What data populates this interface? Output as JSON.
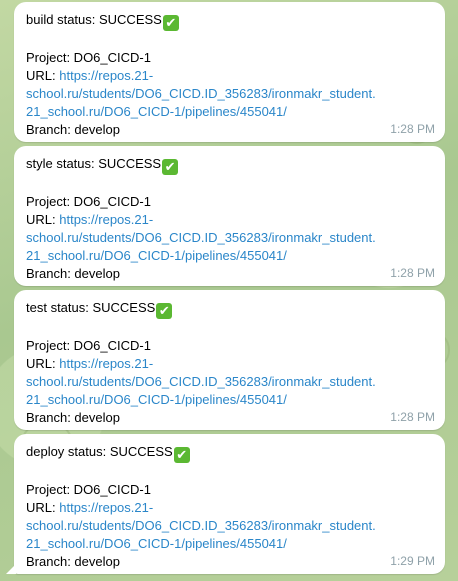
{
  "messages": [
    {
      "status_line": "build status: SUCCESS",
      "status_icon": "white-check-mark-emoji",
      "project_line": "Project: DO6_CICD-1",
      "url_label": "URL: ",
      "url_line1": "https://repos.21-",
      "url_line2": "school.ru/students/DO6_CICD.ID_356283/ironmakr_student.",
      "url_line3": "21_school.ru/DO6_CICD-1/pipelines/455041/",
      "branch_line": "Branch: develop",
      "time": "1:28 PM"
    },
    {
      "status_line": "style status: SUCCESS",
      "status_icon": "white-check-mark-emoji",
      "project_line": "Project: DO6_CICD-1",
      "url_label": "URL: ",
      "url_line1": "https://repos.21-",
      "url_line2": "school.ru/students/DO6_CICD.ID_356283/ironmakr_student.",
      "url_line3": "21_school.ru/DO6_CICD-1/pipelines/455041/",
      "branch_line": "Branch: develop",
      "time": "1:28 PM"
    },
    {
      "status_line": "test status: SUCCESS",
      "status_icon": "white-check-mark-emoji",
      "project_line": "Project: DO6_CICD-1",
      "url_label": "URL: ",
      "url_line1": "https://repos.21-",
      "url_line2": "school.ru/students/DO6_CICD.ID_356283/ironmakr_student.",
      "url_line3": "21_school.ru/DO6_CICD-1/pipelines/455041/",
      "branch_line": "Branch: develop",
      "time": "1:28 PM"
    },
    {
      "status_line": "deploy status: SUCCESS",
      "status_icon": "white-check-mark-emoji",
      "project_line": "Project: DO6_CICD-1",
      "url_label": "URL: ",
      "url_line1": "https://repos.21-",
      "url_line2": "school.ru/students/DO6_CICD.ID_356283/ironmakr_student.",
      "url_line3": "21_school.ru/DO6_CICD-1/pipelines/455041/",
      "branch_line": "Branch: develop",
      "time": "1:29 PM"
    }
  ],
  "colors": {
    "link": "#2a86c9",
    "check_bg": "#5bb832",
    "timestamp": "#8fa1a9",
    "chat_background": "#b5cf9c",
    "bubble": "#ffffff"
  },
  "icons": {
    "check_glyph": "✔"
  }
}
